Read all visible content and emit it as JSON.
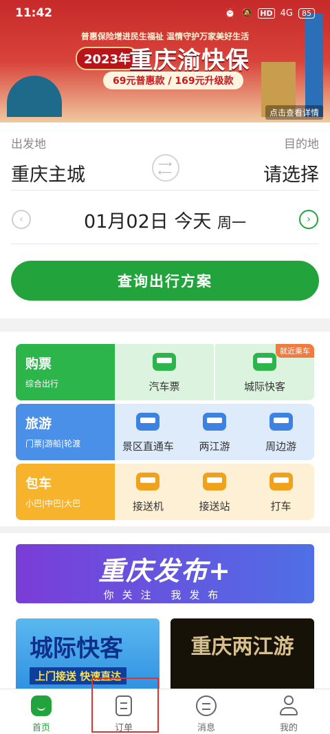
{
  "status_bar": {
    "time": "11:42",
    "network": "4G",
    "battery": "85"
  },
  "banner": {
    "slogan": "普惠保险增进民生福祉 温情守护万家美好生活",
    "year": "2023年",
    "title": "重庆渝快保",
    "price_line": "69元普惠款 / 169元升级款",
    "link": "点击查看详情"
  },
  "route": {
    "origin_label": "出发地",
    "destination_label": "目的地",
    "origin_value": "重庆主城",
    "destination_value": "请选择",
    "date": "01月02日",
    "day": "今天",
    "weekday": "周一",
    "query_button": "查询出行方案"
  },
  "services": [
    {
      "title": "购票",
      "subtitle": "综合出行",
      "items": [
        {
          "label": "汽车票"
        },
        {
          "label": "城际快客",
          "badge": "就近乘车"
        }
      ]
    },
    {
      "title": "旅游",
      "subtitle": "门票|游船|轮渡",
      "items": [
        {
          "label": "景区直通车"
        },
        {
          "label": "两江游"
        },
        {
          "label": "周边游"
        }
      ]
    },
    {
      "title": "包车",
      "subtitle": "小巴|中巴|大巴",
      "items": [
        {
          "label": "接送机"
        },
        {
          "label": "接送站"
        },
        {
          "label": "打车"
        }
      ]
    }
  ],
  "promo": {
    "title": "重庆发布+",
    "subtitle": "你关注 我发布",
    "tile1_title": "城际快客",
    "tile1_sub": "上门接送 快速直达",
    "tile2_title": "重庆两江游"
  },
  "tabs": [
    {
      "label": "首页",
      "active": true
    },
    {
      "label": "订单",
      "active": false
    },
    {
      "label": "消息",
      "active": false
    },
    {
      "label": "我的",
      "active": false
    }
  ],
  "colors": {
    "brand_green": "#22a33b",
    "highlight_red": "#e3312d"
  }
}
